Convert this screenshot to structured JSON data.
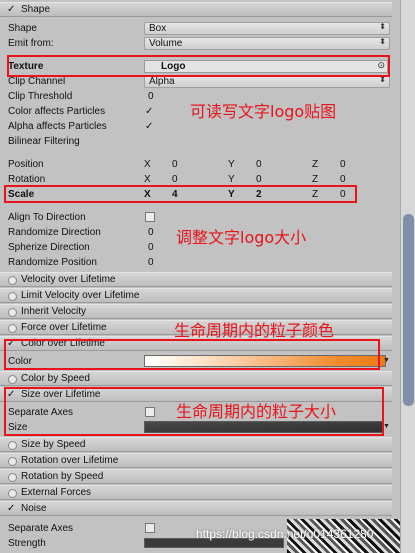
{
  "shape_header": {
    "check": "✓",
    "label": "Shape"
  },
  "shape": {
    "label": "Shape",
    "value": "Box"
  },
  "emit_from": {
    "label": "Emit from:",
    "value": "Volume"
  },
  "texture": {
    "label": "Texture",
    "value": "Logo"
  },
  "clip_channel": {
    "label": "Clip Channel",
    "value": "Alpha"
  },
  "clip_threshold": {
    "label": "Clip Threshold",
    "value": "0"
  },
  "color_affects": {
    "label": "Color affects Particles",
    "check": "✓"
  },
  "alpha_affects": {
    "label": "Alpha affects Particles",
    "check": "✓"
  },
  "bilinear": {
    "label": "Bilinear Filtering"
  },
  "position": {
    "label": "Position",
    "x": "0",
    "y": "0",
    "z": "0"
  },
  "rotation": {
    "label": "Rotation",
    "x": "0",
    "y": "0",
    "z": "0"
  },
  "scale": {
    "label": "Scale",
    "x": "4",
    "y": "2",
    "z": "0"
  },
  "axis": {
    "x": "X",
    "y": "Y",
    "z": "Z"
  },
  "align_dir": {
    "label": "Align To Direction"
  },
  "rand_dir": {
    "label": "Randomize Direction",
    "value": "0"
  },
  "spher_dir": {
    "label": "Spherize Direction",
    "value": "0"
  },
  "rand_pos": {
    "label": "Randomize Position",
    "value": "0"
  },
  "modules": {
    "velocity": "Velocity over Lifetime",
    "limit_velocity": "Limit Velocity over Lifetime",
    "inherit_velocity": "Inherit Velocity",
    "force": "Force over Lifetime",
    "color_over": "Color over Lifetime",
    "color_by_speed": "Color by Speed",
    "size_over": "Size over Lifetime",
    "size_by_speed": "Size by Speed",
    "rotation_over": "Rotation over Lifetime",
    "rotation_by_speed": "Rotation by Speed",
    "external_forces": "External Forces",
    "noise": "Noise"
  },
  "color_row": {
    "label": "Color"
  },
  "separate_axes": {
    "label": "Separate Axes"
  },
  "size_row": {
    "label": "Size"
  },
  "noise_separate": {
    "label": "Separate Axes"
  },
  "strength": {
    "label": "Strength"
  },
  "annotations": {
    "texture_note": "可读写文字logo贴图",
    "scale_note": "调整文字logo大小",
    "color_note": "生命周期内的粒子颜色",
    "size_note": "生命周期内的粒子大小"
  },
  "watermark": "https://blog.csdn.net/u014361280",
  "colors": {
    "annotation": "#e8131b",
    "gradient_end": "#ec7a14"
  }
}
